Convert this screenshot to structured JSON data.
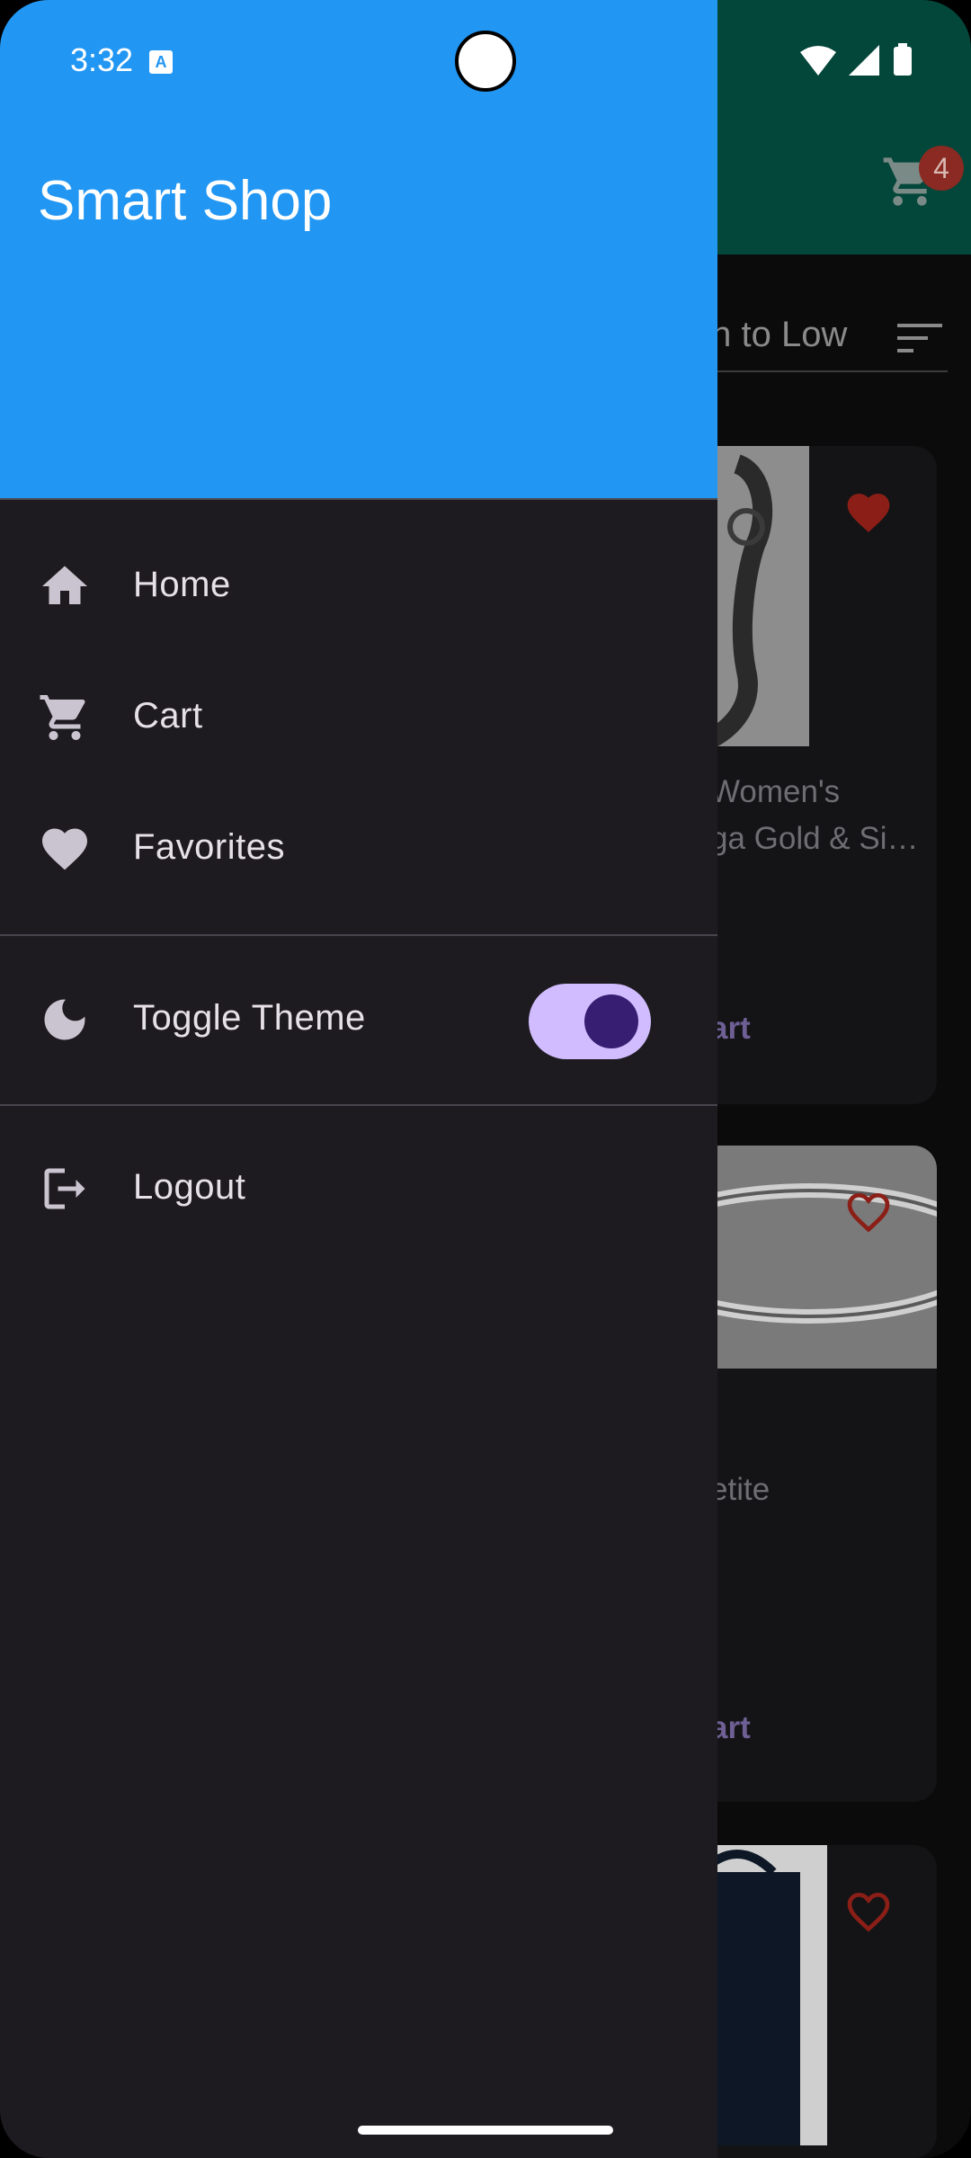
{
  "status_bar": {
    "time": "3:32",
    "notification_icon": "accessibility-a-icon",
    "icons": [
      "wifi-icon",
      "cellular-signal-icon",
      "battery-icon"
    ]
  },
  "drawer": {
    "title": "Smart Shop",
    "header_color": "#2196f3",
    "items": [
      {
        "label": "Home",
        "icon": "home-icon"
      },
      {
        "label": "Cart",
        "icon": "cart-icon"
      },
      {
        "label": "Favorites",
        "icon": "heart-icon"
      }
    ],
    "theme_toggle": {
      "label": "Toggle Theme",
      "icon": "moon-icon",
      "on": true,
      "track_color": "#d0bcff",
      "thumb_color": "#381e72"
    },
    "logout": {
      "label": "Logout",
      "icon": "logout-icon"
    }
  },
  "background_app": {
    "app_bar_color": "#03463a",
    "cart_badge_count": "4",
    "sort_label": "igh to Low",
    "products": [
      {
        "title_lines": [
          "Women's",
          "ga Gold & Si…"
        ],
        "favorite": true,
        "action": "art"
      },
      {
        "title_lines": [
          "etite"
        ],
        "favorite": false,
        "action": "art"
      },
      {
        "title_lines": [],
        "favorite": false,
        "action": ""
      }
    ]
  }
}
